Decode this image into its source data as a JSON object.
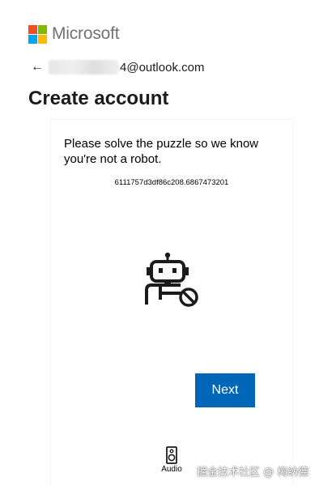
{
  "brand": {
    "name": "Microsoft",
    "logo_colors": [
      "#f25022",
      "#7fba00",
      "#00a4ef",
      "#ffb900"
    ]
  },
  "identity": {
    "back_icon": "arrow-left-icon",
    "email_visible_part": "4@outlook.com"
  },
  "page": {
    "title": "Create account"
  },
  "puzzle": {
    "prompt": "Please solve the puzzle so we know you're not a robot.",
    "session_token": "6111757d3df86c208.6867473201",
    "illustration_icon": "robot-blocked-icon",
    "next_label": "Next",
    "next_color": "#0067b8",
    "audio_label": "Audio",
    "audio_icon": "speaker-icon"
  },
  "watermark": {
    "text": "掘金技术社区 @ 梅纳德"
  }
}
